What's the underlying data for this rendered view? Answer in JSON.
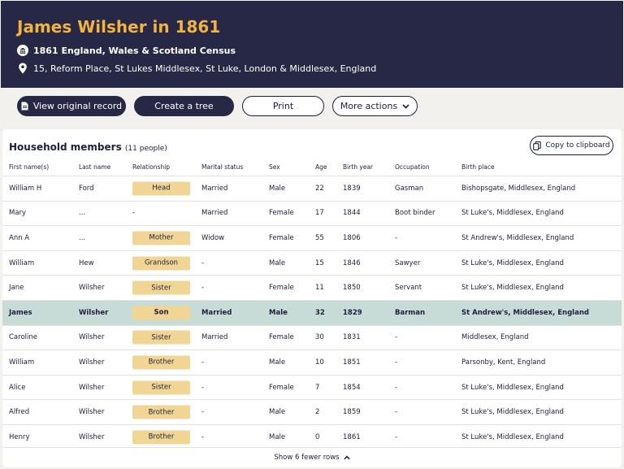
{
  "header": {
    "title": "James Wilsher in 1861",
    "census": "1861 England, Wales & Scotland Census",
    "address": "15, Reform Place, St Lukes Middlesex, St Luke, London & Middlesex, England"
  },
  "actions": {
    "view_original": "View original record",
    "create_tree": "Create a tree",
    "print": "Print",
    "more_actions": "More actions"
  },
  "household": {
    "title": "Household members",
    "count": "(11 people)",
    "copy_label": "Copy to clipboard",
    "columns": [
      "First name(s)",
      "Last name",
      "Relationship",
      "Marital status",
      "Sex",
      "Age",
      "Birth year",
      "Occupation",
      "Birth place"
    ],
    "rows": [
      {
        "first": "William H",
        "last": "Ford",
        "relationship": "Head",
        "marital": "Married",
        "sex": "Male",
        "age": "22",
        "birth_year": "1839",
        "occupation": "Gasman",
        "birth_place": "Bishopsgate, Middlesex, England"
      },
      {
        "first": "Mary",
        "last": "...",
        "relationship": "-",
        "marital": "Married",
        "sex": "Female",
        "age": "17",
        "birth_year": "1844",
        "occupation": "Boot binder",
        "birth_place": "St Luke's, Middlesex, England"
      },
      {
        "first": "Ann A",
        "last": "...",
        "relationship": "Mother",
        "marital": "Widow",
        "sex": "Female",
        "age": "55",
        "birth_year": "1806",
        "occupation": "-",
        "birth_place": "St Andrew's, Middlesex, England"
      },
      {
        "first": "William",
        "last": "Hew",
        "relationship": "Grandson",
        "marital": "-",
        "sex": "Male",
        "age": "15",
        "birth_year": "1846",
        "occupation": "Sawyer",
        "birth_place": "St Luke's, Middlesex, England"
      },
      {
        "first": "Jane",
        "last": "Wilsher",
        "relationship": "Sister",
        "marital": "-",
        "sex": "Female",
        "age": "11",
        "birth_year": "1850",
        "occupation": "Servant",
        "birth_place": "St Luke's, Middlesex, England"
      },
      {
        "first": "James",
        "last": "Wilsher",
        "relationship": "Son",
        "marital": "Married",
        "sex": "Male",
        "age": "32",
        "birth_year": "1829",
        "occupation": "Barman",
        "birth_place": "St Andrew's, Middlesex, England"
      },
      {
        "first": "Caroline",
        "last": "Wilsher",
        "relationship": "Sister",
        "marital": "Married",
        "sex": "Female",
        "age": "30",
        "birth_year": "1831",
        "occupation": "-",
        "birth_place": "Middlesex, England"
      },
      {
        "first": "William",
        "last": "Wilsher",
        "relationship": "Brother",
        "marital": "-",
        "sex": "Male",
        "age": "10",
        "birth_year": "1851",
        "occupation": "-",
        "birth_place": "Parsonby, Kent, England"
      },
      {
        "first": "Alice",
        "last": "Wilsher",
        "relationship": "Sister",
        "marital": "-",
        "sex": "Female",
        "age": "7",
        "birth_year": "1854",
        "occupation": "-",
        "birth_place": "St Luke's, Middlesex, England"
      },
      {
        "first": "Alfred",
        "last": "Wilsher",
        "relationship": "Brother",
        "marital": "-",
        "sex": "Male",
        "age": "2",
        "birth_year": "1859",
        "occupation": "-",
        "birth_place": "St Luke's, Middlesex, England"
      },
      {
        "first": "Henry",
        "last": "Wilsher",
        "relationship": "Brother",
        "marital": "-",
        "sex": "Male",
        "age": "0",
        "birth_year": "1861",
        "occupation": "-",
        "birth_place": "St Luke's, Middlesex, England"
      }
    ],
    "highlighted_row": 5,
    "show_fewer": "Show 6 fewer rows"
  },
  "colors": {
    "navy": "#272845",
    "gold": "#f2b441",
    "tag": "#f0d595",
    "highlight": "#c8dcd7"
  },
  "icons": [
    "census-icon",
    "location-pin-icon",
    "document-icon",
    "chevron-down-icon",
    "copy-icon",
    "chevron-up-icon"
  ]
}
